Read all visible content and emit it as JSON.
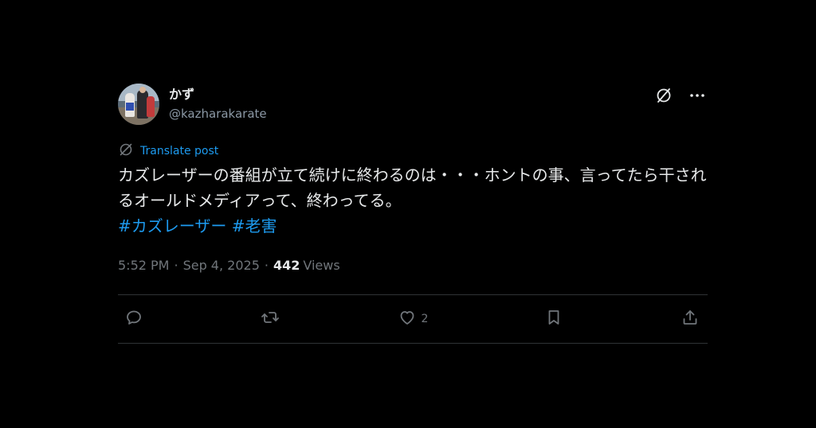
{
  "author": {
    "display_name": "かず",
    "handle": "@kazharakarate"
  },
  "translate": {
    "label": "Translate post"
  },
  "post": {
    "text": "カズレーザーの番組が立て続けに終わるのは・・・ホントの事、言ってたら干されるオールドメディアって、終わってる。",
    "hashtags": [
      "#カズレーザー",
      "#老害"
    ]
  },
  "meta": {
    "time": "5:52 PM",
    "separator": "·",
    "date": "Sep 4, 2025",
    "views_count": "442",
    "views_label": "Views"
  },
  "actions": {
    "reply_count": "",
    "repost_count": "",
    "like_count": "2",
    "bookmark_count": ""
  },
  "icons": {
    "grok": "grok-icon",
    "more": "more-icon",
    "translate": "translate-icon",
    "reply": "reply-icon",
    "repost": "repost-icon",
    "like": "heart-icon",
    "bookmark": "bookmark-icon",
    "share": "share-icon"
  },
  "colors": {
    "background": "#000000",
    "text": "#e7e9ea",
    "secondary": "#71767b",
    "accent": "#1d9bf0",
    "divider": "#2f3336"
  }
}
